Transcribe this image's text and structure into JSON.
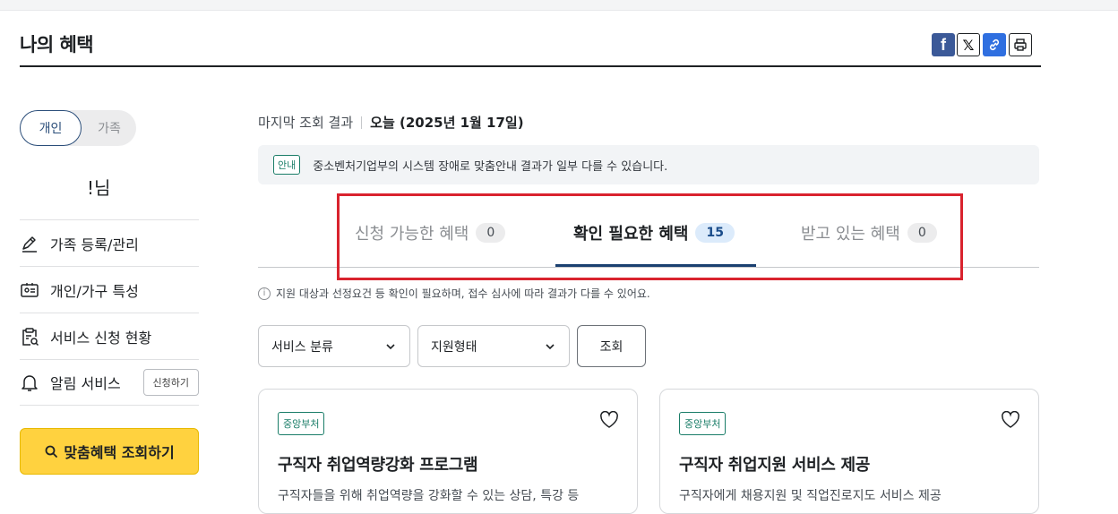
{
  "header": {
    "title": "나의 혜택"
  },
  "share": {
    "facebook_icon": "f",
    "x_icon": "𝕏"
  },
  "sidebar": {
    "toggle": {
      "active": "개인",
      "inactive": "가족"
    },
    "user_name": "!님",
    "items": [
      {
        "label": "가족 등록/관리",
        "icon": "pencil-icon"
      },
      {
        "label": "개인/가구 특성",
        "icon": "id-card-icon"
      },
      {
        "label": "서비스 신청 현황",
        "icon": "clipboard-search-icon"
      },
      {
        "label": "알림 서비스",
        "icon": "bell-icon",
        "button": "신청하기"
      }
    ],
    "cta": "맞춤혜택 조회하기"
  },
  "main": {
    "last_query_label": "마지막 조회 결과",
    "last_query_value": "오늘 (2025년 1월 17일)",
    "notice_tag": "안내",
    "notice_text": "중소벤처기업부의 시스템 장애로 맞춤안내 결과가 일부 다를 수 있습니다.",
    "tabs": [
      {
        "label": "신청 가능한 혜택",
        "count": "0"
      },
      {
        "label": "확인 필요한 혜택",
        "count": "15",
        "active": true
      },
      {
        "label": "받고 있는 혜택",
        "count": "0"
      }
    ],
    "info_text": "지원 대상과 선정요건 등 확인이 필요하며, 접수 심사에 따라 결과가 다를 수 있어요.",
    "filters": {
      "category": "서비스 분류",
      "type": "지원형태",
      "search": "조회"
    },
    "cards": [
      {
        "badge": "중앙부처",
        "title": "구직자 취업역량강화 프로그램",
        "desc": "구직자들을 위해 취업역량을 강화할 수 있는 상담, 특강 등"
      },
      {
        "badge": "중앙부처",
        "title": "구직자 취업지원 서비스 제공",
        "desc": "구직자에게 채용지원 및 직업진로지도 서비스 제공"
      }
    ]
  },
  "colors": {
    "accent": "#1a4070",
    "cta": "#ffd23f",
    "highlight": "#d9232e",
    "badge": "#1a7d68"
  }
}
